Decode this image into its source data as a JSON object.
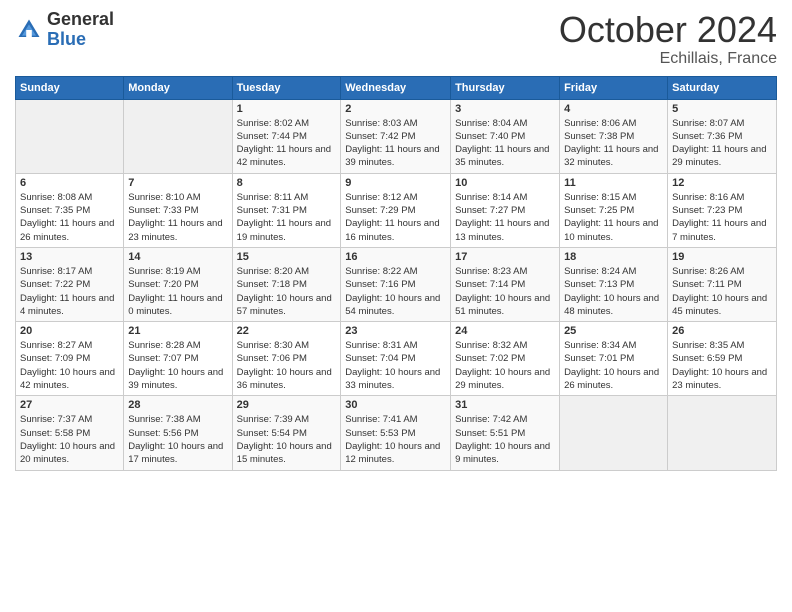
{
  "logo": {
    "general": "General",
    "blue": "Blue"
  },
  "header": {
    "month": "October 2024",
    "location": "Echillais, France"
  },
  "weekdays": [
    "Sunday",
    "Monday",
    "Tuesday",
    "Wednesday",
    "Thursday",
    "Friday",
    "Saturday"
  ],
  "weeks": [
    [
      {
        "day": "",
        "info": ""
      },
      {
        "day": "",
        "info": ""
      },
      {
        "day": "1",
        "info": "Sunrise: 8:02 AM\nSunset: 7:44 PM\nDaylight: 11 hours and 42 minutes."
      },
      {
        "day": "2",
        "info": "Sunrise: 8:03 AM\nSunset: 7:42 PM\nDaylight: 11 hours and 39 minutes."
      },
      {
        "day": "3",
        "info": "Sunrise: 8:04 AM\nSunset: 7:40 PM\nDaylight: 11 hours and 35 minutes."
      },
      {
        "day": "4",
        "info": "Sunrise: 8:06 AM\nSunset: 7:38 PM\nDaylight: 11 hours and 32 minutes."
      },
      {
        "day": "5",
        "info": "Sunrise: 8:07 AM\nSunset: 7:36 PM\nDaylight: 11 hours and 29 minutes."
      }
    ],
    [
      {
        "day": "6",
        "info": "Sunrise: 8:08 AM\nSunset: 7:35 PM\nDaylight: 11 hours and 26 minutes."
      },
      {
        "day": "7",
        "info": "Sunrise: 8:10 AM\nSunset: 7:33 PM\nDaylight: 11 hours and 23 minutes."
      },
      {
        "day": "8",
        "info": "Sunrise: 8:11 AM\nSunset: 7:31 PM\nDaylight: 11 hours and 19 minutes."
      },
      {
        "day": "9",
        "info": "Sunrise: 8:12 AM\nSunset: 7:29 PM\nDaylight: 11 hours and 16 minutes."
      },
      {
        "day": "10",
        "info": "Sunrise: 8:14 AM\nSunset: 7:27 PM\nDaylight: 11 hours and 13 minutes."
      },
      {
        "day": "11",
        "info": "Sunrise: 8:15 AM\nSunset: 7:25 PM\nDaylight: 11 hours and 10 minutes."
      },
      {
        "day": "12",
        "info": "Sunrise: 8:16 AM\nSunset: 7:23 PM\nDaylight: 11 hours and 7 minutes."
      }
    ],
    [
      {
        "day": "13",
        "info": "Sunrise: 8:17 AM\nSunset: 7:22 PM\nDaylight: 11 hours and 4 minutes."
      },
      {
        "day": "14",
        "info": "Sunrise: 8:19 AM\nSunset: 7:20 PM\nDaylight: 11 hours and 0 minutes."
      },
      {
        "day": "15",
        "info": "Sunrise: 8:20 AM\nSunset: 7:18 PM\nDaylight: 10 hours and 57 minutes."
      },
      {
        "day": "16",
        "info": "Sunrise: 8:22 AM\nSunset: 7:16 PM\nDaylight: 10 hours and 54 minutes."
      },
      {
        "day": "17",
        "info": "Sunrise: 8:23 AM\nSunset: 7:14 PM\nDaylight: 10 hours and 51 minutes."
      },
      {
        "day": "18",
        "info": "Sunrise: 8:24 AM\nSunset: 7:13 PM\nDaylight: 10 hours and 48 minutes."
      },
      {
        "day": "19",
        "info": "Sunrise: 8:26 AM\nSunset: 7:11 PM\nDaylight: 10 hours and 45 minutes."
      }
    ],
    [
      {
        "day": "20",
        "info": "Sunrise: 8:27 AM\nSunset: 7:09 PM\nDaylight: 10 hours and 42 minutes."
      },
      {
        "day": "21",
        "info": "Sunrise: 8:28 AM\nSunset: 7:07 PM\nDaylight: 10 hours and 39 minutes."
      },
      {
        "day": "22",
        "info": "Sunrise: 8:30 AM\nSunset: 7:06 PM\nDaylight: 10 hours and 36 minutes."
      },
      {
        "day": "23",
        "info": "Sunrise: 8:31 AM\nSunset: 7:04 PM\nDaylight: 10 hours and 33 minutes."
      },
      {
        "day": "24",
        "info": "Sunrise: 8:32 AM\nSunset: 7:02 PM\nDaylight: 10 hours and 29 minutes."
      },
      {
        "day": "25",
        "info": "Sunrise: 8:34 AM\nSunset: 7:01 PM\nDaylight: 10 hours and 26 minutes."
      },
      {
        "day": "26",
        "info": "Sunrise: 8:35 AM\nSunset: 6:59 PM\nDaylight: 10 hours and 23 minutes."
      }
    ],
    [
      {
        "day": "27",
        "info": "Sunrise: 7:37 AM\nSunset: 5:58 PM\nDaylight: 10 hours and 20 minutes."
      },
      {
        "day": "28",
        "info": "Sunrise: 7:38 AM\nSunset: 5:56 PM\nDaylight: 10 hours and 17 minutes."
      },
      {
        "day": "29",
        "info": "Sunrise: 7:39 AM\nSunset: 5:54 PM\nDaylight: 10 hours and 15 minutes."
      },
      {
        "day": "30",
        "info": "Sunrise: 7:41 AM\nSunset: 5:53 PM\nDaylight: 10 hours and 12 minutes."
      },
      {
        "day": "31",
        "info": "Sunrise: 7:42 AM\nSunset: 5:51 PM\nDaylight: 10 hours and 9 minutes."
      },
      {
        "day": "",
        "info": ""
      },
      {
        "day": "",
        "info": ""
      }
    ]
  ]
}
